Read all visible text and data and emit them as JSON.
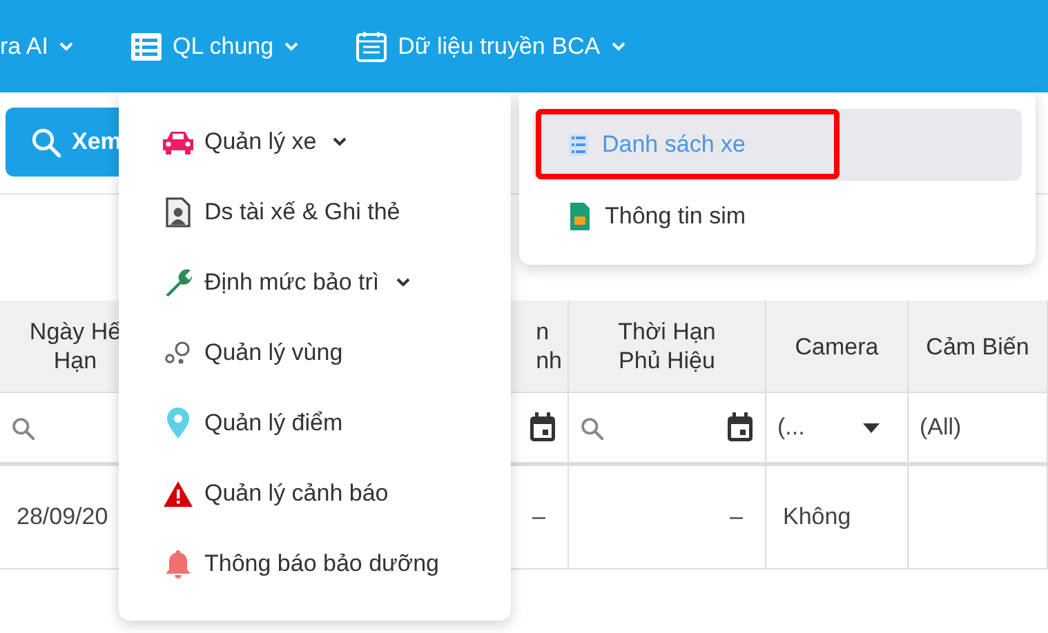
{
  "nav": {
    "items": [
      {
        "label": "ra AI"
      },
      {
        "label": "QL chung"
      },
      {
        "label": "Dữ liệu truyền BCA"
      }
    ]
  },
  "toolbar": {
    "view_button": "Xem"
  },
  "table": {
    "columns": [
      {
        "header_lines": [
          "Ngày Hế",
          "Hạn"
        ],
        "filter": {
          "kind": "search"
        }
      },
      {
        "header_lines": [
          "n",
          "nh"
        ],
        "filter": {
          "kind": "date"
        }
      },
      {
        "header_lines": [
          "Thời Hạn",
          "Phủ Hiệu"
        ],
        "filter": {
          "kind": "search_date"
        }
      },
      {
        "header_lines": [
          "Camera"
        ],
        "filter": {
          "kind": "select",
          "value": "(..."
        }
      },
      {
        "header_lines": [
          "Cảm Biến"
        ],
        "filter": {
          "kind": "value",
          "value": "(All)"
        }
      }
    ],
    "rows": [
      [
        "28/09/20",
        "–",
        "–",
        "Không"
      ]
    ]
  },
  "menu": {
    "items": [
      {
        "label": "Quản lý xe",
        "has_submenu": true
      },
      {
        "label": "Ds tài xế & Ghi thẻ",
        "has_submenu": false
      },
      {
        "label": "Định mức bảo trì",
        "has_submenu": true
      },
      {
        "label": "Quản lý vùng",
        "has_submenu": false
      },
      {
        "label": "Quản lý điểm",
        "has_submenu": false
      },
      {
        "label": "Quản lý cảnh báo",
        "has_submenu": false
      },
      {
        "label": "Thông báo bảo dưỡng",
        "has_submenu": false
      }
    ]
  },
  "submenu": {
    "items": [
      {
        "label": "Danh sách xe",
        "selected": true,
        "highlighted": true
      },
      {
        "label": "Thông tin sim",
        "selected": false,
        "highlighted": false
      }
    ]
  }
}
